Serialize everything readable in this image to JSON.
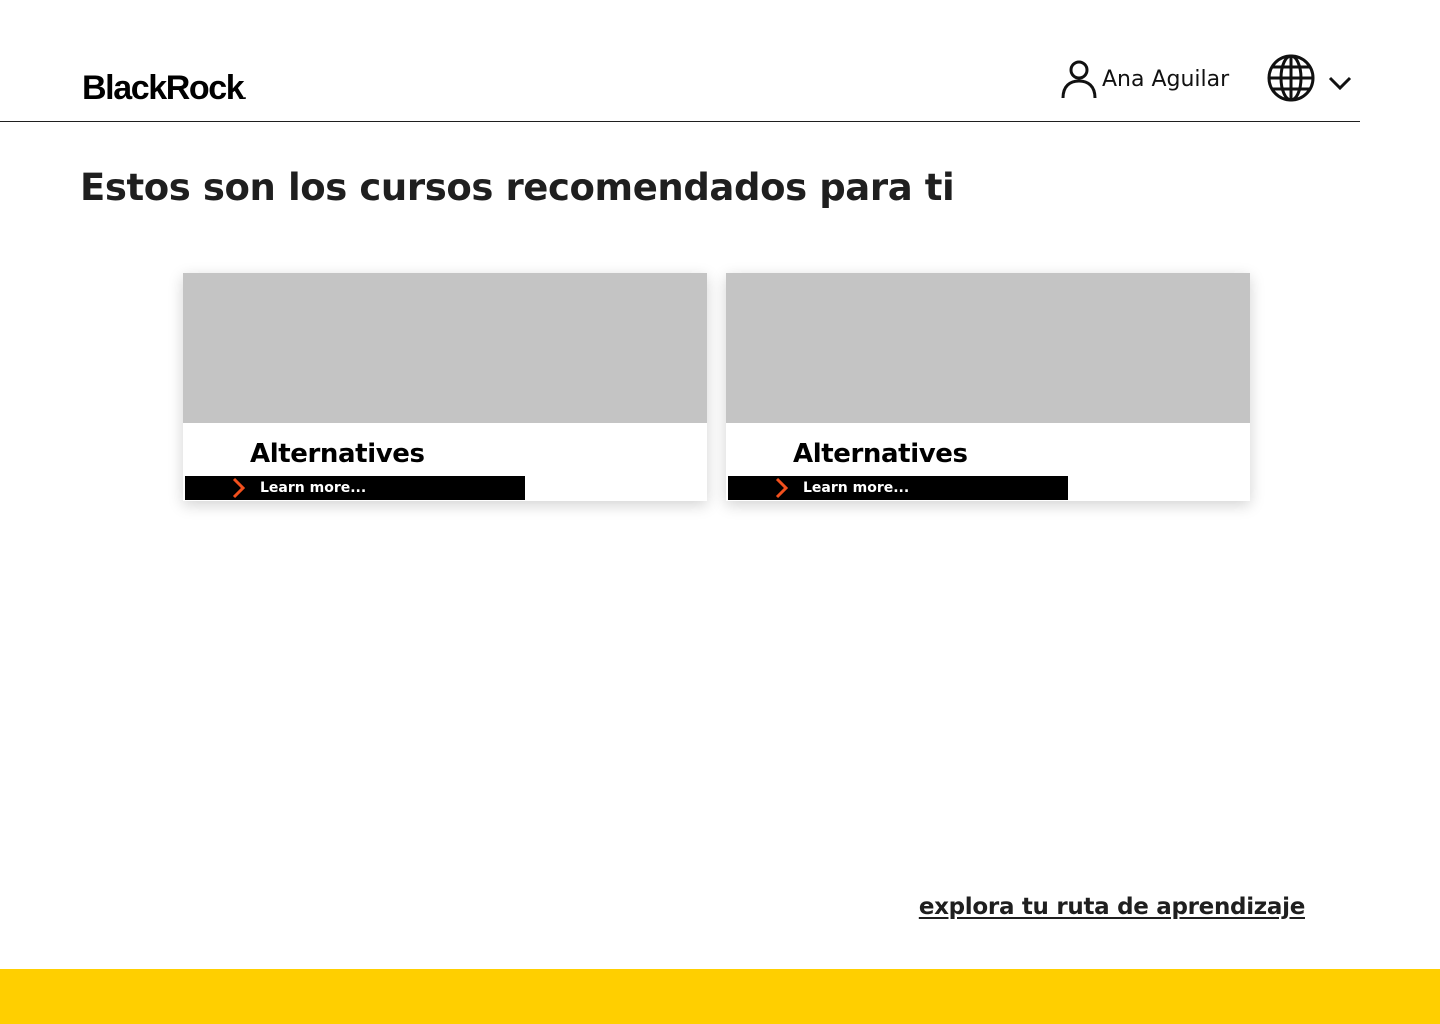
{
  "header": {
    "logo_text": "BlackRock",
    "logo_dot": ".",
    "user": {
      "name": "Ana Aguilar",
      "icon": "user-icon"
    },
    "language": {
      "icon": "globe-icon",
      "dropdown_icon": "chevron-down-icon"
    }
  },
  "main": {
    "title": "Estos son los cursos recomendados para ti",
    "courses": [
      {
        "title": "Alternatives",
        "cta_label": "Learn more...",
        "cta_icon": "chevron-right-icon"
      },
      {
        "title": "Alternatives",
        "cta_label": "Learn more...",
        "cta_icon": "chevron-right-icon"
      }
    ],
    "explore_link": "explora tu ruta de aprendizaje"
  },
  "colors": {
    "accent_yellow": "#ffcf00",
    "arrow_orange": "#f2501d",
    "image_placeholder": "#c4c4c4",
    "cta_background": "#000000"
  }
}
